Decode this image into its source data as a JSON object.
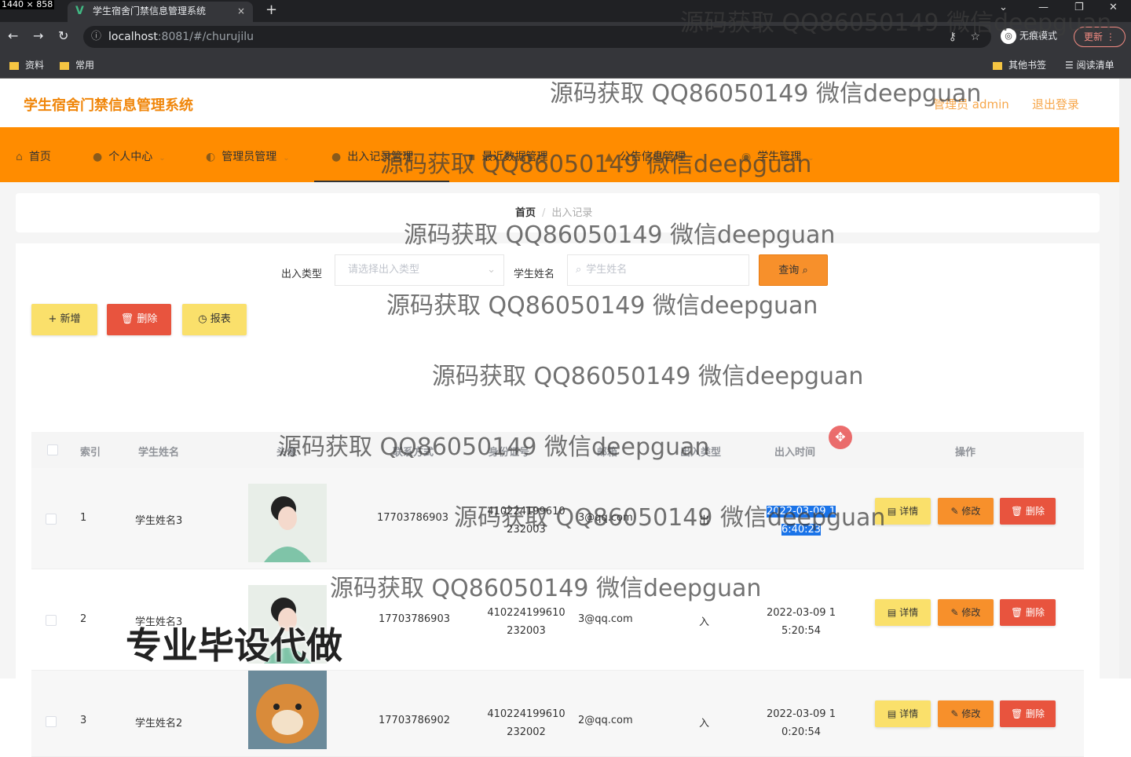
{
  "browser": {
    "dims_label": "1440 × 858",
    "tab_title": "学生宿舍门禁信息管理系统",
    "tab_close": "×",
    "new_tab": "+",
    "url_host": "localhost",
    "url_path": ":8081/#/churujilu",
    "incognito_label": "无痕模式",
    "update_label": "更新",
    "bookmarks": [
      "资料",
      "常用"
    ],
    "bookmarks_right": [
      "其他书签",
      "阅读清单"
    ]
  },
  "header": {
    "brand": "学生宿舍门禁信息管理系统",
    "admin": "管理员 admin",
    "logout": "退出登录"
  },
  "nav": {
    "items": [
      {
        "label": "首页"
      },
      {
        "label": "个人中心"
      },
      {
        "label": "管理员管理"
      },
      {
        "label": "出入记录管理"
      },
      {
        "label": "最近数据管理"
      },
      {
        "label": "公告信息管理"
      },
      {
        "label": "学生管理"
      }
    ]
  },
  "breadcrumb": {
    "home": "首页",
    "sep": "/",
    "current": "出入记录"
  },
  "filters": {
    "type_label": "出入类型",
    "type_placeholder": "请选择出入类型",
    "name_label": "学生姓名",
    "name_placeholder": "学生姓名",
    "query_label": "查询"
  },
  "toolbar": {
    "add": "+ 新增",
    "delete": "删除",
    "report": "报表"
  },
  "table": {
    "columns": [
      "索引",
      "学生姓名",
      "头像",
      "联系方式",
      "身份证号",
      "邮箱",
      "出入类型",
      "出入时间",
      "操作"
    ],
    "rows": [
      {
        "index": "1",
        "name": "学生姓名3",
        "phone": "17703786903",
        "id1": "410224199610",
        "id2": "232003",
        "email": "3@qq.com",
        "type": "出",
        "time1": "2022-03-09 1",
        "time2": "6:40:23"
      },
      {
        "index": "2",
        "name": "学生姓名3",
        "phone": "17703786903",
        "id1": "410224199610",
        "id2": "232003",
        "email": "3@qq.com",
        "type": "入",
        "time1": "2022-03-09 1",
        "time2": "5:20:54"
      },
      {
        "index": "3",
        "name": "学生姓名2",
        "phone": "17703786902",
        "id1": "410224199610",
        "id2": "232002",
        "email": "2@qq.com",
        "type": "入",
        "time1": "2022-03-09 1",
        "time2": "0:20:54"
      }
    ],
    "actions": {
      "detail": "详情",
      "edit": "修改",
      "remove": "删除"
    }
  },
  "watermarks": {
    "text": "源码获取 QQ86050149 微信deepguan",
    "big": "专业毕设代做"
  },
  "colors": {
    "accent": "#ff8c00",
    "brand": "#f0860a",
    "danger": "#e8543e",
    "warn": "#fae06b"
  }
}
